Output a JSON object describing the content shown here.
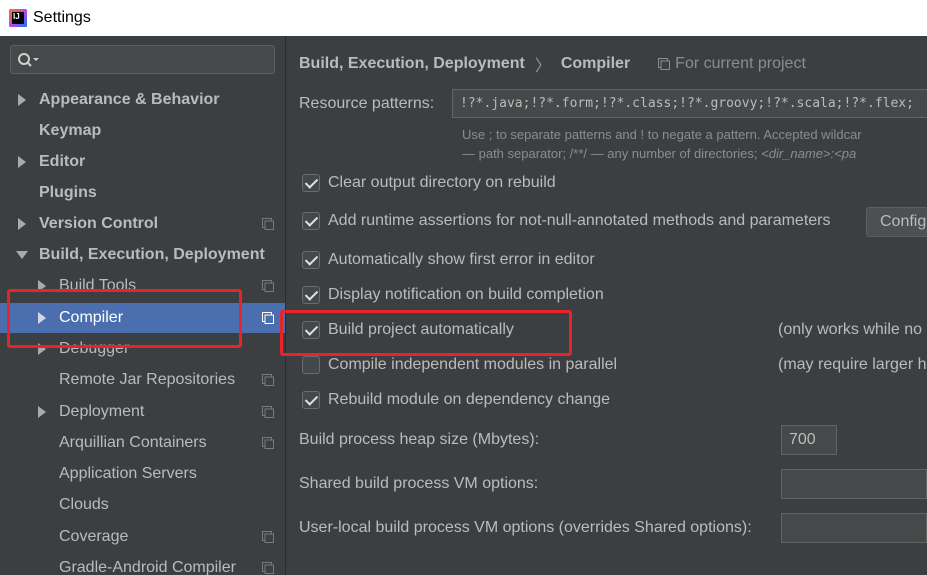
{
  "window": {
    "title": "Settings"
  },
  "search": {
    "placeholder": ""
  },
  "sidebar": {
    "items": [
      {
        "label": "Appearance & Behavior"
      },
      {
        "label": "Keymap"
      },
      {
        "label": "Editor"
      },
      {
        "label": "Plugins"
      },
      {
        "label": "Version Control"
      },
      {
        "label": "Build, Execution, Deployment"
      },
      {
        "label": "Build Tools"
      },
      {
        "label": "Compiler"
      },
      {
        "label": "Debugger"
      },
      {
        "label": "Remote Jar Repositories"
      },
      {
        "label": "Deployment"
      },
      {
        "label": "Arquillian Containers"
      },
      {
        "label": "Application Servers"
      },
      {
        "label": "Clouds"
      },
      {
        "label": "Coverage"
      },
      {
        "label": "Gradle-Android Compiler"
      }
    ]
  },
  "breadcrumb": {
    "parent": "Build, Execution, Deployment",
    "separator": "〉",
    "current": "Compiler",
    "scope": "For current project"
  },
  "resource": {
    "label": "Resource patterns:",
    "value": "!?*.java;!?*.form;!?*.class;!?*.groovy;!?*.scala;!?*.flex;",
    "hint_line1": "Use ; to separate patterns and ! to negate a pattern. Accepted wildcar",
    "hint_line2_a": "— path separator; /**/ — any number of directories; ",
    "hint_line2_b": "<dir_name>:<pa"
  },
  "options": [
    {
      "label": "Clear output directory on rebuild",
      "checked": true
    },
    {
      "label": "Add runtime assertions for not-null-annotated methods and parameters",
      "checked": true
    },
    {
      "label": "Automatically show first error in editor",
      "checked": true
    },
    {
      "label": "Display notification on build completion",
      "checked": true
    },
    {
      "label": "Build project automatically",
      "checked": true,
      "note": "(only works while no"
    },
    {
      "label": "Compile independent modules in parallel",
      "checked": false,
      "note": "(may require larger h"
    },
    {
      "label": "Rebuild module on dependency change",
      "checked": true
    }
  ],
  "config_button": {
    "label": "Config"
  },
  "heap": {
    "label": "Build process heap size (Mbytes):",
    "value": "700"
  },
  "shared_vm": {
    "label": "Shared build process VM options:",
    "value": ""
  },
  "user_vm": {
    "label": "User-local build process VM options (overrides Shared options):",
    "value": ""
  },
  "colors": {
    "selection": "#4b6eaf",
    "annotation": "#e8232a",
    "panel": "#3c3f41"
  }
}
